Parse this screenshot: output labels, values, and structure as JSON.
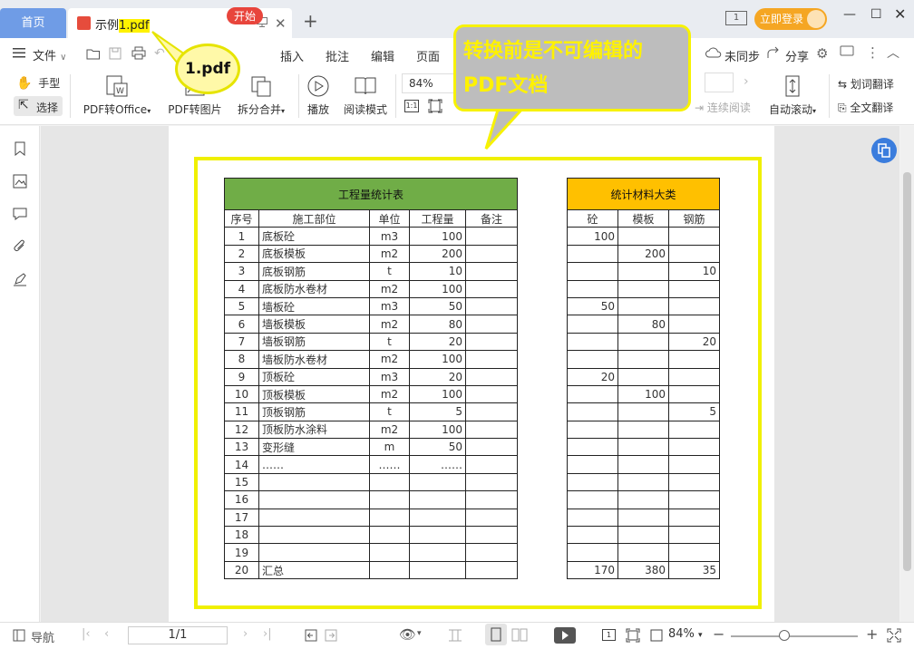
{
  "tabs": {
    "home": "首页",
    "doc_prefix": "示例",
    "doc_highlight": "1.pdf"
  },
  "titlebar": {
    "page_badge": "1",
    "login": "立即登录"
  },
  "menu": {
    "file": "文件",
    "items": [
      "开始",
      "插入",
      "批注",
      "编辑",
      "页面"
    ],
    "sync": "未同步",
    "share": "分享"
  },
  "toolbar": {
    "hand": "手型",
    "select": "选择",
    "pdf_to_office": "PDF转Office",
    "pdf_to_image": "PDF转图片",
    "split_merge": "拆分合并",
    "play": "播放",
    "read_mode": "阅读模式",
    "zoom": "84%",
    "continuous_read": "连续阅读",
    "auto_scroll": "自动滚动",
    "word_translate": "划词翻译",
    "full_translate": "全文翻译"
  },
  "callouts": {
    "file": "1.pdf",
    "note_line1": "转换前是不可编辑的",
    "note_line2": "PDF文档"
  },
  "table_left": {
    "title": "工程量统计表",
    "headers": [
      "序号",
      "施工部位",
      "单位",
      "工程量",
      "备注"
    ],
    "rows": [
      [
        "1",
        "底板砼",
        "m3",
        "100",
        ""
      ],
      [
        "2",
        "底板模板",
        "m2",
        "200",
        ""
      ],
      [
        "3",
        "底板钢筋",
        "t",
        "10",
        ""
      ],
      [
        "4",
        "底板防水卷材",
        "m2",
        "100",
        ""
      ],
      [
        "5",
        "墙板砼",
        "m3",
        "50",
        ""
      ],
      [
        "6",
        "墙板模板",
        "m2",
        "80",
        ""
      ],
      [
        "7",
        "墙板钢筋",
        "t",
        "20",
        ""
      ],
      [
        "8",
        "墙板防水卷材",
        "m2",
        "100",
        ""
      ],
      [
        "9",
        "顶板砼",
        "m3",
        "20",
        ""
      ],
      [
        "10",
        "顶板模板",
        "m2",
        "100",
        ""
      ],
      [
        "11",
        "顶板钢筋",
        "t",
        "5",
        ""
      ],
      [
        "12",
        "顶板防水涂料",
        "m2",
        "100",
        ""
      ],
      [
        "13",
        "变形缝",
        "m",
        "50",
        ""
      ],
      [
        "14",
        "……",
        "……",
        "……",
        ""
      ],
      [
        "15",
        "",
        "",
        "",
        ""
      ],
      [
        "16",
        "",
        "",
        "",
        ""
      ],
      [
        "17",
        "",
        "",
        "",
        ""
      ],
      [
        "18",
        "",
        "",
        "",
        ""
      ],
      [
        "19",
        "",
        "",
        "",
        ""
      ],
      [
        "20",
        "汇总",
        "",
        "",
        ""
      ]
    ]
  },
  "table_right": {
    "title": "统计材料大类",
    "headers": [
      "砼",
      "模板",
      "钢筋"
    ],
    "rows": [
      [
        "100",
        "",
        ""
      ],
      [
        "",
        "200",
        ""
      ],
      [
        "",
        "",
        "10"
      ],
      [
        "",
        "",
        ""
      ],
      [
        "50",
        "",
        ""
      ],
      [
        "",
        "80",
        ""
      ],
      [
        "",
        "",
        "20"
      ],
      [
        "",
        "",
        ""
      ],
      [
        "20",
        "",
        ""
      ],
      [
        "",
        "100",
        ""
      ],
      [
        "",
        "",
        "5"
      ],
      [
        "",
        "",
        ""
      ],
      [
        "",
        "",
        ""
      ],
      [
        "",
        "",
        ""
      ],
      [
        "",
        "",
        ""
      ],
      [
        "",
        "",
        ""
      ],
      [
        "",
        "",
        ""
      ],
      [
        "",
        "",
        ""
      ],
      [
        "",
        "",
        ""
      ],
      [
        "170",
        "380",
        "35"
      ]
    ]
  },
  "statusbar": {
    "nav": "导航",
    "page": "1/1",
    "page_badge": "1",
    "zoom": "84%"
  },
  "colors": {
    "tab_home": "#6f9ce6",
    "accent_red": "#e8453c",
    "login_orange": "#f5a623",
    "table_green": "#70ad47",
    "table_orange": "#ffc000",
    "highlight_yellow": "#f0f000"
  }
}
